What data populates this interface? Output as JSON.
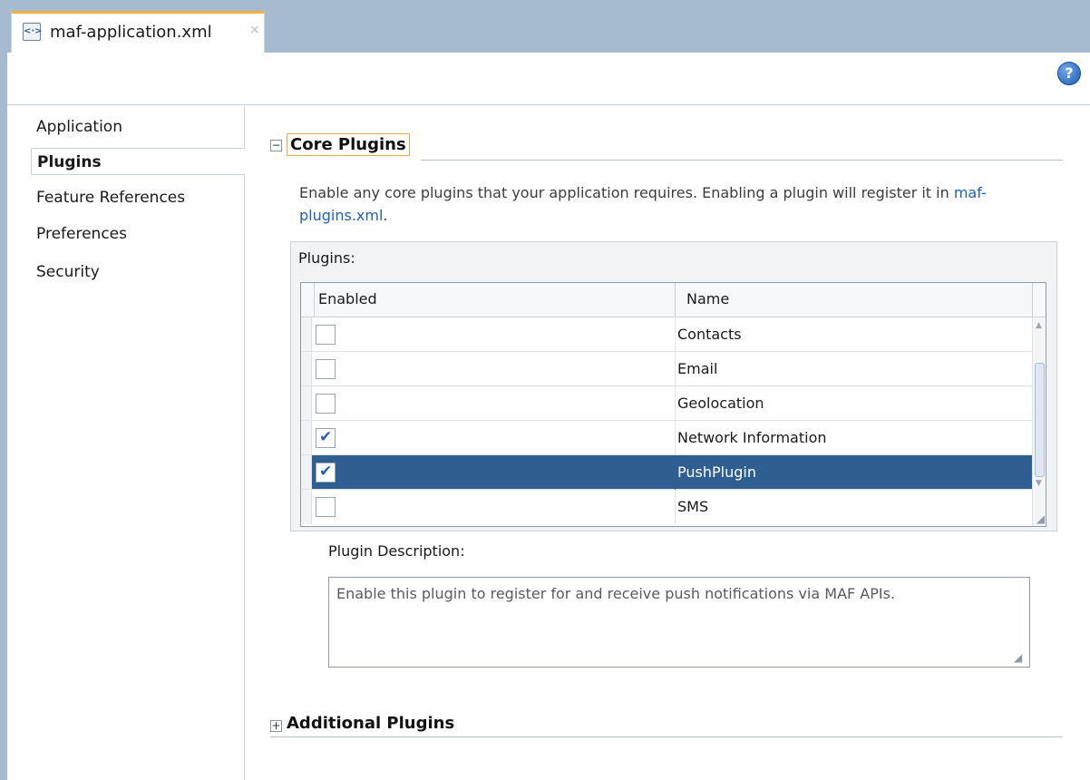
{
  "editor": {
    "tab_title": "maf-application.xml",
    "tab_icon": "xml-file-icon",
    "close_glyph": "×",
    "help_glyph": "?"
  },
  "sidebar": {
    "items": [
      {
        "label": "Application",
        "selected": false
      },
      {
        "label": "Plugins",
        "selected": true
      },
      {
        "label": "Feature References",
        "selected": false
      },
      {
        "label": "Preferences",
        "selected": false
      },
      {
        "label": "Security",
        "selected": false
      }
    ]
  },
  "core_plugins": {
    "title": "Core Plugins",
    "expanded": true,
    "description_prefix": "Enable any core plugins that your application requires. Enabling a plugin will register it in ",
    "description_link": "maf-plugins.xml",
    "description_suffix": ".",
    "plugins_label": "Plugins:",
    "columns": [
      "Enabled",
      "Name"
    ],
    "rows": [
      {
        "name": "Contacts",
        "enabled": false,
        "selected": false
      },
      {
        "name": "Email",
        "enabled": false,
        "selected": false
      },
      {
        "name": "Geolocation",
        "enabled": false,
        "selected": false
      },
      {
        "name": "Network Information",
        "enabled": true,
        "selected": false
      },
      {
        "name": "PushPlugin",
        "enabled": true,
        "selected": true
      },
      {
        "name": "SMS",
        "enabled": false,
        "selected": false
      }
    ],
    "plugin_description_label": "Plugin Description:",
    "plugin_description": "Enable this plugin to register for and receive push notifications via MAF APIs."
  },
  "additional_plugins": {
    "title": "Additional Plugins",
    "expanded": false
  },
  "colors": {
    "tabstrip": "#a6bad0",
    "tab_accent": "#f5b04a",
    "selection": "#2f5f91",
    "link": "#1f5fbf"
  }
}
